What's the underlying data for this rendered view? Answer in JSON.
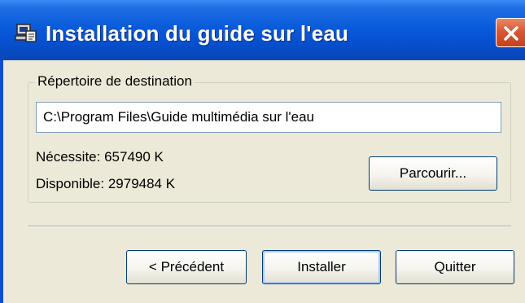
{
  "window": {
    "title": "Installation du guide sur l'eau"
  },
  "icons": {
    "app": "installer-computer-icon",
    "close": "close-icon"
  },
  "colors": {
    "titlebar": "#0A5BDA",
    "close_button": "#DB5631",
    "dialog_background": "#ECE9D8",
    "button_border": "#003C74"
  },
  "destination": {
    "group_label": "Répertoire de destination",
    "path_value": "C:\\Program Files\\Guide multimédia sur l'eau",
    "required_label": "Nécessite: 657490 K",
    "available_label": "Disponible: 2979484 K",
    "browse_label": "Parcourir..."
  },
  "buttons": {
    "previous_label": "< Précédent",
    "install_label": "Installer",
    "quit_label": "Quitter"
  }
}
